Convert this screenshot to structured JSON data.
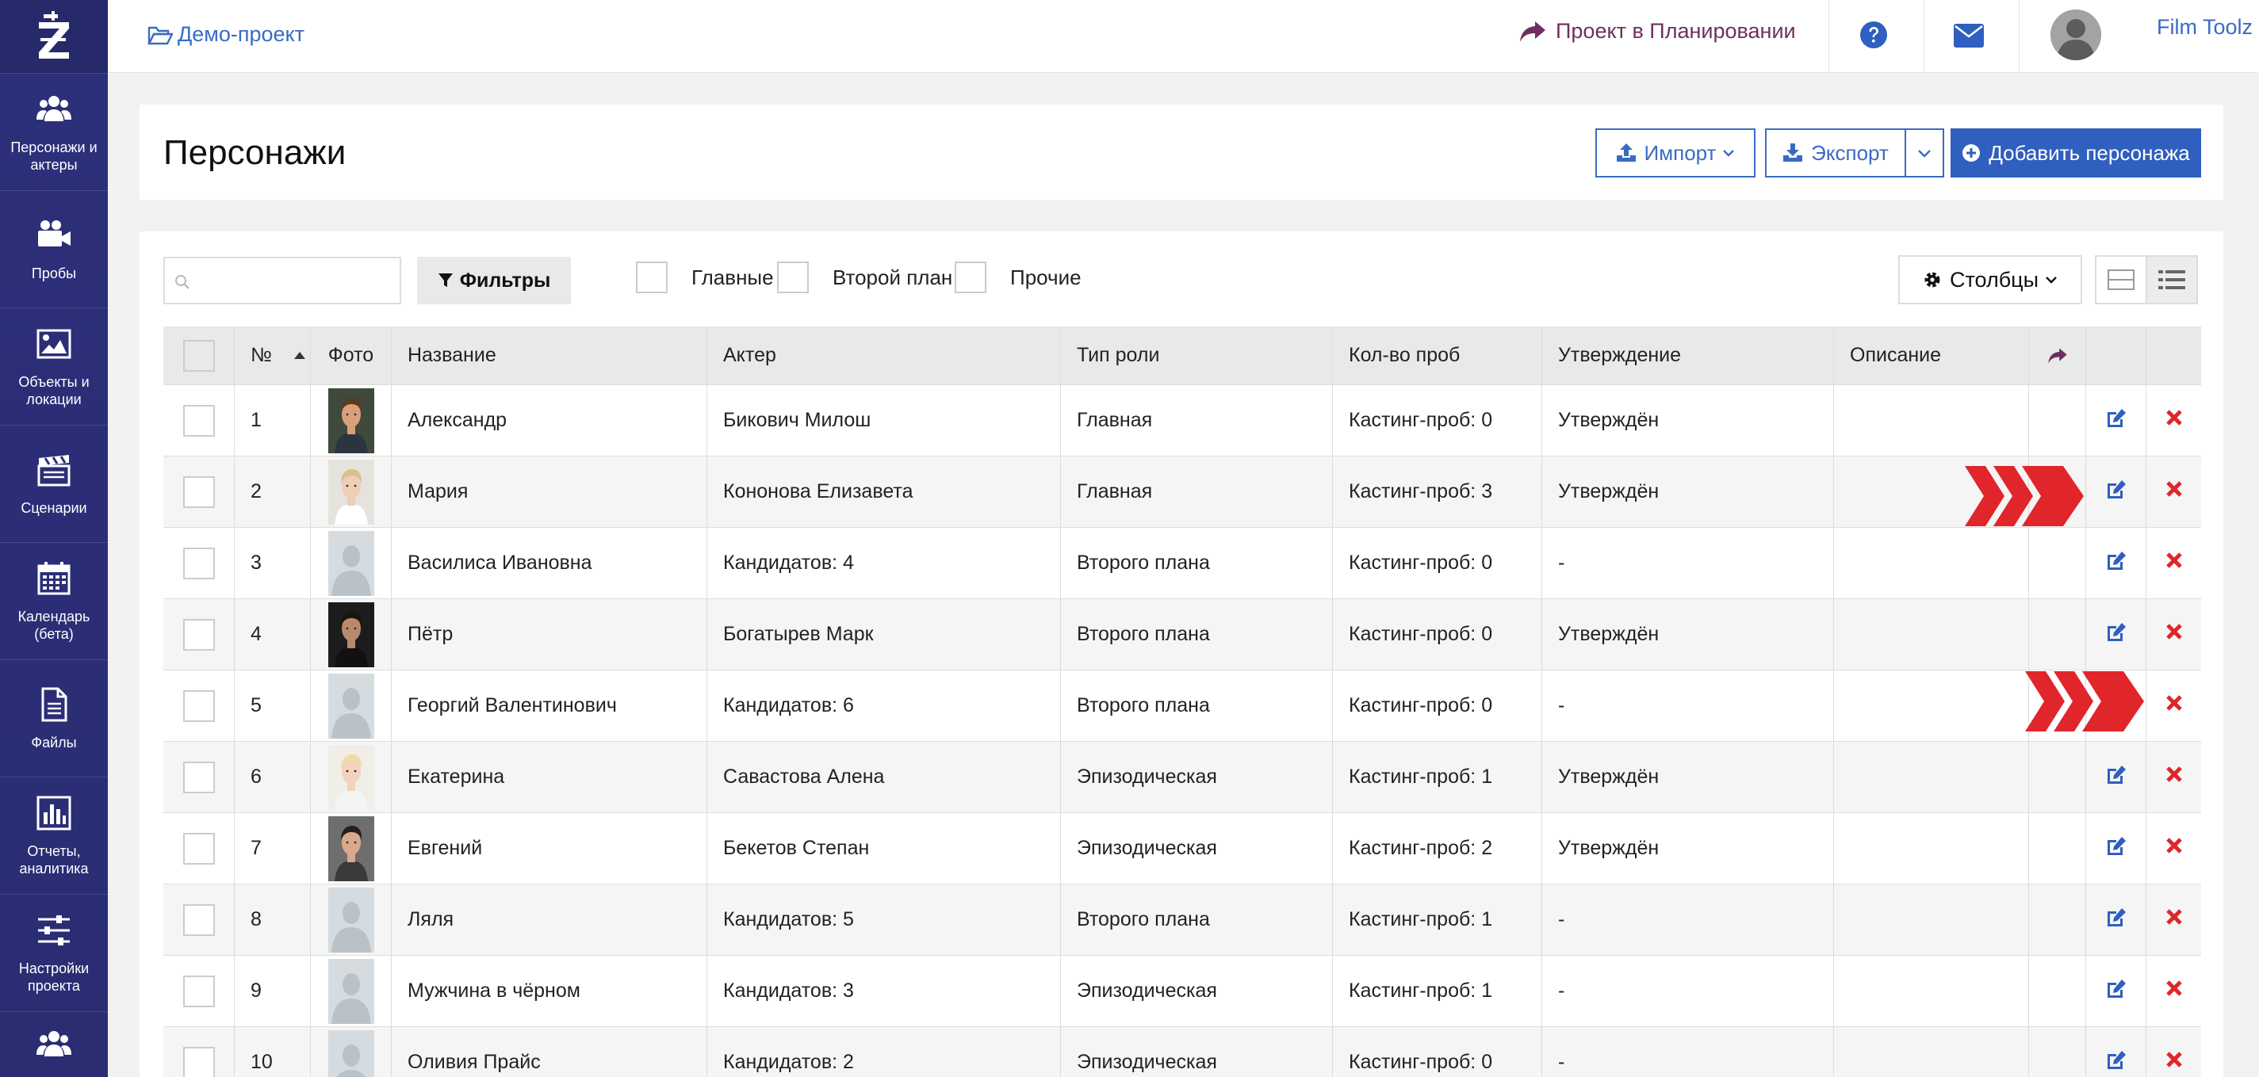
{
  "breadcrumb": "Демо-проект",
  "plan_link": "Проект в Планировании",
  "user_name": "Film Toolz",
  "logo_letter": "Z",
  "sidebar": {
    "items": [
      {
        "label": "Персонажи и актеры",
        "icon": "users-icon"
      },
      {
        "label": "Пробы",
        "icon": "video-camera-icon"
      },
      {
        "label": "Объекты и локации",
        "icon": "image-icon"
      },
      {
        "label": "Сценарии",
        "icon": "clapperboard-icon"
      },
      {
        "label": "Календарь (бета)",
        "icon": "calendar-icon"
      },
      {
        "label": "Файлы",
        "icon": "file-icon"
      },
      {
        "label": "Отчеты, аналитика",
        "icon": "bar-chart-icon"
      },
      {
        "label": "Настройки проекта",
        "icon": "sliders-icon"
      },
      {
        "label": "",
        "icon": "users-icon"
      }
    ]
  },
  "page_title": "Персонажи",
  "buttons": {
    "import": "Импорт",
    "export": "Экспорт",
    "add": "Добавить персонажа",
    "filters": "Фильтры",
    "columns": "Столбцы"
  },
  "checkbox_filters": [
    "Главные",
    "Второй план",
    "Прочие"
  ],
  "table": {
    "headers": [
      "№",
      "Фото",
      "Название",
      "Актер",
      "Тип роли",
      "Кол-во проб",
      "Утверждение",
      "Описание"
    ],
    "rows": [
      {
        "num": "1",
        "name": "Александр",
        "actor": "Бикович Милош",
        "role": "Главная",
        "tests": "Кастинг-проб: 0",
        "approval": "Утверждён",
        "photo": "photo-a"
      },
      {
        "num": "2",
        "name": "Мария",
        "actor": "Кононова Елизавета",
        "role": "Главная",
        "tests": "Кастинг-проб: 3",
        "approval": "Утверждён",
        "photo": "photo-b"
      },
      {
        "num": "3",
        "name": "Василиса Ивановна",
        "actor": "Кандидатов: 4",
        "role": "Второго плана",
        "tests": "Кастинг-проб: 0",
        "approval": "-",
        "photo": "placeholder"
      },
      {
        "num": "4",
        "name": "Пётр",
        "actor": "Богатырев Марк",
        "role": "Второго плана",
        "tests": "Кастинг-проб: 0",
        "approval": "Утверждён",
        "photo": "photo-c"
      },
      {
        "num": "5",
        "name": "Георгий Валентинович",
        "actor": "Кандидатов: 6",
        "role": "Второго плана",
        "tests": "Кастинг-проб: 0",
        "approval": "-",
        "photo": "placeholder"
      },
      {
        "num": "6",
        "name": "Екатерина",
        "actor": "Савастова Алена",
        "role": "Эпизодическая",
        "tests": "Кастинг-проб: 1",
        "approval": "Утверждён",
        "photo": "photo-d"
      },
      {
        "num": "7",
        "name": "Евгений",
        "actor": "Бекетов Степан",
        "role": "Эпизодическая",
        "tests": "Кастинг-проб: 2",
        "approval": "Утверждён",
        "photo": "photo-e"
      },
      {
        "num": "8",
        "name": "Ляля",
        "actor": "Кандидатов: 5",
        "role": "Второго плана",
        "tests": "Кастинг-проб: 1",
        "approval": "-",
        "photo": "placeholder"
      },
      {
        "num": "9",
        "name": "Мужчина в чёрном",
        "actor": "Кандидатов: 3",
        "role": "Эпизодическая",
        "tests": "Кастинг-проб: 1",
        "approval": "-",
        "photo": "placeholder"
      },
      {
        "num": "10",
        "name": "Оливия Прайс",
        "actor": "Кандидатов: 2",
        "role": "Эпизодическая",
        "tests": "Кастинг-проб: 0",
        "approval": "-",
        "photo": "placeholder"
      }
    ]
  },
  "colors": {
    "sidebar_bg": "#2c2f7a",
    "link_blue": "#3a6bc4",
    "primary_btn": "#2f5fbf",
    "plan_purple": "#6d2f63",
    "delete_red": "#e0262b",
    "edit_blue": "#2f5fbf",
    "annotation_arrows": "#e0262b"
  }
}
